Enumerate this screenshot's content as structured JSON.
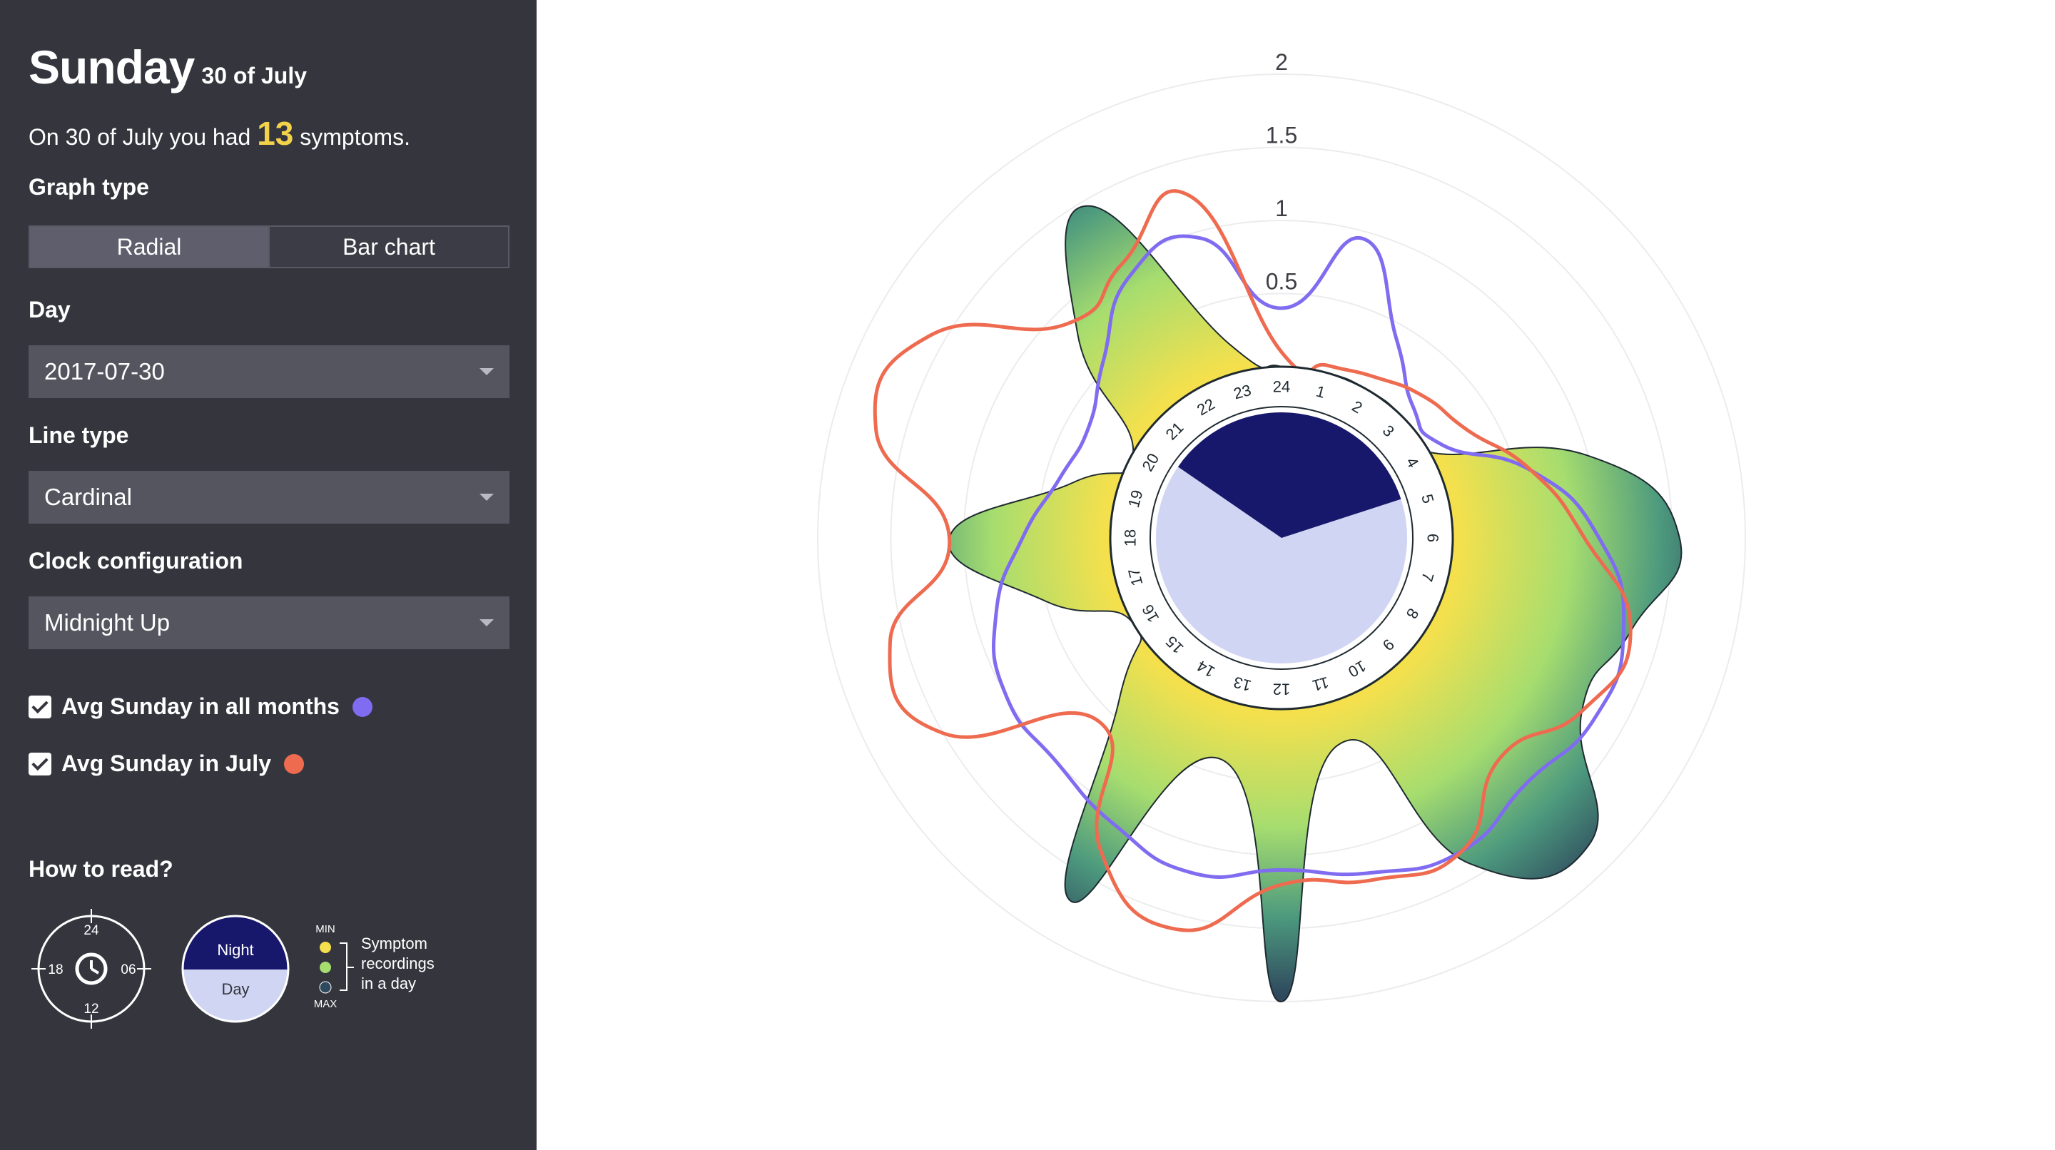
{
  "sidebar": {
    "day_name": "Sunday",
    "date_label": "30 of July",
    "summary_prefix": "On 30 of July you had",
    "symptom_count": "13",
    "summary_suffix": "symptoms.",
    "graph_type_label": "Graph type",
    "graph_type_options": [
      "Radial",
      "Bar chart"
    ],
    "graph_type_selected": "Radial",
    "day_label": "Day",
    "day_value": "2017-07-30",
    "line_type_label": "Line type",
    "line_type_value": "Cardinal",
    "clock_config_label": "Clock configuration",
    "clock_config_value": "Midnight Up",
    "checkboxes": [
      {
        "label": "Avg Sunday in all months",
        "checked": true,
        "color": "#7f6cf0"
      },
      {
        "label": "Avg Sunday in July",
        "checked": true,
        "color": "#ee6b50"
      }
    ],
    "how_to_read": {
      "title": "How to read?",
      "clock_ticks": [
        "24",
        "06",
        "12",
        "18"
      ],
      "night_label": "Night",
      "day_label": "Day",
      "scale_min": "MIN",
      "scale_max": "MAX",
      "scale_desc": [
        "Symptom",
        "recordings",
        "in a day"
      ]
    }
  },
  "colors": {
    "sidebar_bg": "#35353e",
    "accent_count": "#f2d24a",
    "all_months_line": "#7f6cf0",
    "month_line": "#ee6b50",
    "night": "#17186b",
    "day": "#d0d5f3",
    "gradient": [
      "#f4e04d",
      "#a6dd6f",
      "#2f4a5e"
    ]
  },
  "chart_data": {
    "type": "radial-area",
    "clock_configuration": "Midnight Up",
    "radial_axis": {
      "ticks": [
        0.5,
        1,
        1.5,
        2
      ],
      "tick_labels": [
        "0.5",
        "1",
        "1.5",
        "2"
      ],
      "max": 2,
      "grid": true
    },
    "angular_axis": {
      "hours": [
        "24",
        "1",
        "2",
        "3",
        "4",
        "5",
        "6",
        "7",
        "8",
        "9",
        "10",
        "11",
        "12",
        "13",
        "14",
        "15",
        "16",
        "17",
        "18",
        "19",
        "20",
        "21",
        "22",
        "23"
      ]
    },
    "night_period": {
      "start_hour": 20.3,
      "end_hour": 4.8
    },
    "series": [
      {
        "name": "Sunday 30 of July",
        "style": "gradient-area",
        "hours": [
          0,
          1,
          2,
          3,
          4,
          5,
          6,
          7,
          8,
          9,
          10,
          11,
          12,
          13,
          14,
          15,
          16,
          17,
          18,
          19,
          20,
          21,
          22,
          23
        ],
        "values": [
          0,
          0,
          0,
          0,
          0,
          1.0,
          1.55,
          1.3,
          1.2,
          1.8,
          1.4,
          0.3,
          2.0,
          0.4,
          1.7,
          0.4,
          0,
          0.5,
          1.1,
          0.3,
          0,
          0.8,
          1.45,
          0.2
        ]
      },
      {
        "name": "Avg Sunday in all months",
        "style": "line",
        "color": "#7f6cf0",
        "hours": [
          0,
          1,
          2,
          3,
          4,
          5,
          6,
          7,
          8,
          9,
          10,
          11,
          12,
          13,
          14,
          15,
          16,
          17,
          18,
          19,
          20,
          21,
          22,
          23
        ],
        "values": [
          0.4,
          0.95,
          0.4,
          0.1,
          0.1,
          0.6,
          1.0,
          1.25,
          1.3,
          1.2,
          1.3,
          1.2,
          1.1,
          1.2,
          1.1,
          1.0,
          1.0,
          0.85,
          0.6,
          0.4,
          0.35,
          0.55,
          0.9,
          0.95
        ]
      },
      {
        "name": "Avg Sunday in July",
        "style": "line",
        "color": "#ee6b50",
        "hours": [
          0,
          1,
          2,
          3,
          4,
          5,
          6,
          7,
          8,
          9,
          10,
          11,
          12,
          13,
          14,
          15,
          16,
          17,
          18,
          19,
          20,
          21,
          22,
          23
        ],
        "values": [
          0.1,
          0.05,
          0.1,
          0.2,
          0.3,
          0.6,
          0.9,
          1.3,
          1.2,
          0.95,
          1.3,
          1.25,
          1.2,
          1.6,
          1.3,
          0.6,
          1.5,
          1.6,
          1.1,
          1.7,
          1.6,
          0.9,
          1.0,
          1.25
        ]
      }
    ]
  }
}
